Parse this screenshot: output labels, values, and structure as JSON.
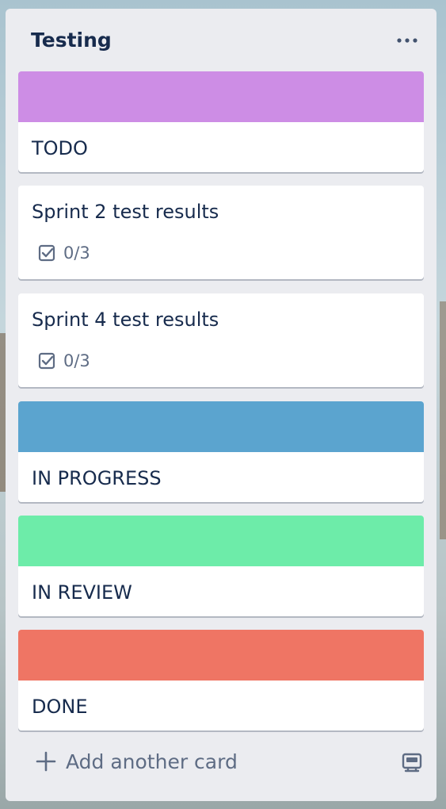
{
  "list": {
    "title": "Testing",
    "menu_icon": "ellipsis-icon"
  },
  "cards": [
    {
      "type": "cover",
      "cover_color": "#cd8de5",
      "title": "TODO"
    },
    {
      "type": "checklist",
      "title": "Sprint 2 test results",
      "checklist": "0/3",
      "icon": "checklist-icon"
    },
    {
      "type": "checklist",
      "title": "Sprint 4 test results",
      "checklist": "0/3",
      "icon": "checklist-icon"
    },
    {
      "type": "cover",
      "cover_color": "#5ba4cf",
      "title": "IN PROGRESS"
    },
    {
      "type": "cover",
      "cover_color": "#6deca9",
      "title": "IN REVIEW"
    },
    {
      "type": "cover",
      "cover_color": "#ef7564",
      "title": "DONE"
    }
  ],
  "composer": {
    "add_label": "Add another card",
    "add_icon": "plus-icon",
    "template_icon": "card-template-icon"
  }
}
